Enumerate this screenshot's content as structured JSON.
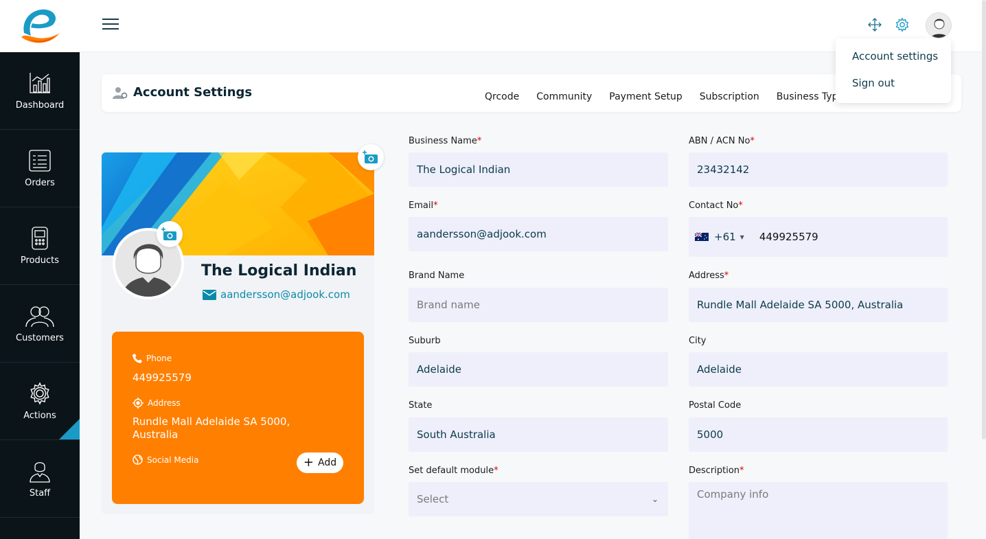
{
  "header": {
    "title": "Account Settings",
    "tabs": [
      "Qrcode",
      "Community",
      "Payment Setup",
      "Subscription",
      "Business Type"
    ]
  },
  "dropdown": {
    "items": [
      "Account settings",
      "Sign out"
    ]
  },
  "sidebar": {
    "items": [
      {
        "label": "Dashboard",
        "icon": "chart-icon"
      },
      {
        "label": "Orders",
        "icon": "list-icon"
      },
      {
        "label": "Products",
        "icon": "device-icon"
      },
      {
        "label": "Customers",
        "icon": "users-icon"
      },
      {
        "label": "Actions",
        "icon": "gear-icon"
      },
      {
        "label": "Staff",
        "icon": "user-icon"
      }
    ]
  },
  "profile": {
    "name": "The Logical Indian",
    "email": "aandersson@adjook.com",
    "phone_label": "Phone",
    "phone": "449925579",
    "address_label": "Address",
    "address": "Rundle Mall Adelaide SA 5000, Australia",
    "social_label": "Social Media",
    "add_label": "Add"
  },
  "form": {
    "business_name": {
      "label": "Business Name",
      "value": "The Logical Indian"
    },
    "abn": {
      "label": "ABN / ACN No",
      "value": "23432142"
    },
    "email": {
      "label": "Email",
      "value": "aandersson@adjook.com"
    },
    "contact": {
      "label": "Contact No",
      "country_code": "+61",
      "value": "449925579"
    },
    "brand_name": {
      "label": "Brand Name",
      "placeholder": "Brand name"
    },
    "address": {
      "label": "Address",
      "value": "Rundle Mall Adelaide SA 5000, Australia"
    },
    "suburb": {
      "label": "Suburb",
      "value": "Adelaide"
    },
    "city": {
      "label": "City",
      "value": "Adelaide"
    },
    "state": {
      "label": "State",
      "value": "South Australia"
    },
    "postal_code": {
      "label": "Postal Code",
      "value": "5000"
    },
    "default_module": {
      "label": "Set default module",
      "placeholder": "Select"
    },
    "description": {
      "label": "Description",
      "placeholder": "Company info"
    }
  },
  "colors": {
    "sidebar_bg": "#0b1419",
    "accent": "#1a9bc6",
    "info_card": "#ff7f00",
    "field_bg": "#eeeffb"
  }
}
